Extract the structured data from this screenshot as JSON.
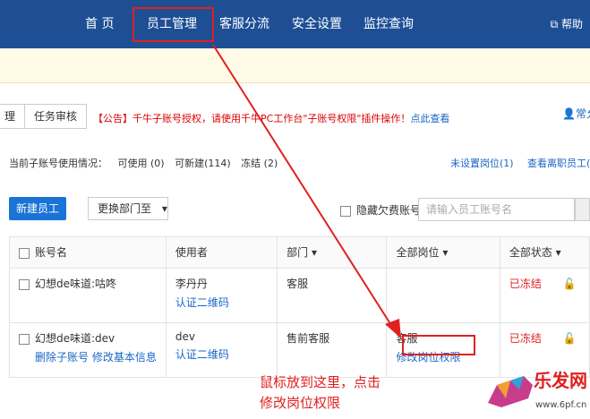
{
  "nav": {
    "items": [
      "首 页",
      "员工管理",
      "客服分流",
      "安全设置",
      "监控查询"
    ],
    "help": "帮助"
  },
  "tabs": [
    "理",
    "任务审核"
  ],
  "announcement": {
    "tag": "【公告】",
    "text": "千牛子账号授权，请使用千牛PC工作台\"子账号权限\"插件操作！",
    "link": "点此查看"
  },
  "user_right": "常允",
  "stats": {
    "label": "当前子账号使用情况：",
    "usable": "可使用 (0)",
    "new": "可新建(114)",
    "frozen": "冻结 (2)",
    "unset_position": "未设置岗位(1)",
    "view_resigned": "查看离职员工("
  },
  "toolbar": {
    "new_employee": "新建员工",
    "change_dept": "更换部门至",
    "hide_overdue": "隐藏欠费账号",
    "search_placeholder": "请输入员工账号名"
  },
  "table": {
    "headers": [
      "账号名",
      "使用者",
      "部门",
      "全部岗位",
      "全部状态"
    ],
    "rows": [
      {
        "account": "幻想de味道:咕咚",
        "user": "李丹丹",
        "user_link": "认证二维码",
        "dept": "客服",
        "position": "",
        "position_link": "",
        "status": "已冻结",
        "actions": []
      },
      {
        "account": "幻想de味道:dev",
        "user": "dev",
        "user_link": "认证二维码",
        "dept": "售前客服",
        "position": "客服",
        "position_link": "修改岗位权限",
        "status": "已冻结",
        "actions": [
          "删除子账号",
          "修改基本信息"
        ]
      }
    ]
  },
  "annotation": [
    "鼠标放到这里，点击",
    "修改岗位权限"
  ],
  "watermark": {
    "brand": "乐发网",
    "url": "www.6pf.cn"
  },
  "colors": {
    "nav_bg": "#1e4f95",
    "accent": "#1a73d6",
    "alert": "#e02020"
  }
}
